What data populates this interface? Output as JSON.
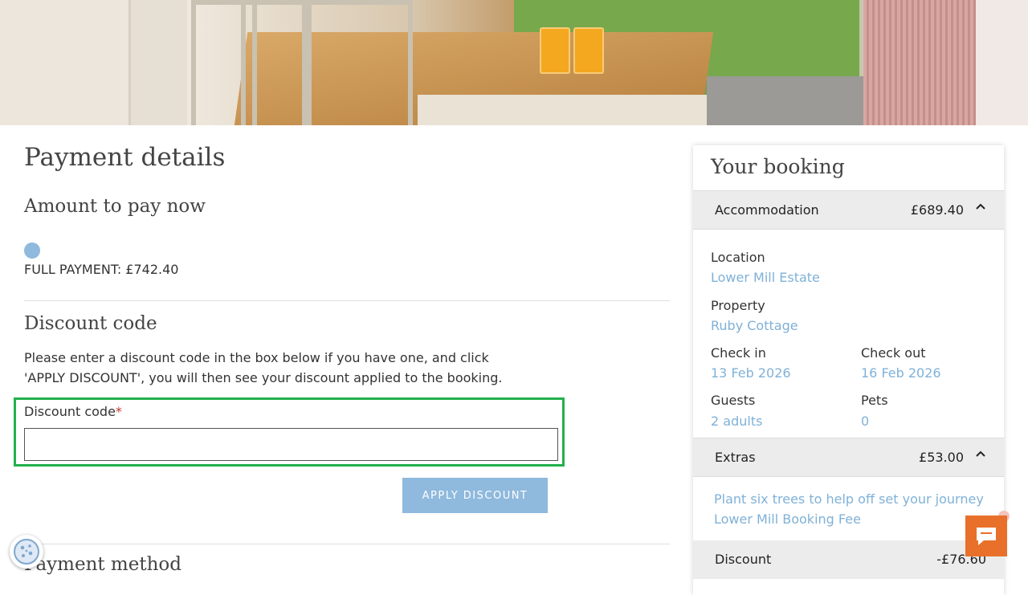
{
  "payment": {
    "title": "Payment details",
    "amount_heading": "Amount to pay now",
    "full_payment_label": "FULL PAYMENT: £742.40"
  },
  "discount": {
    "heading": "Discount code",
    "instructions": "Please enter a discount code in the box below if you have one, and click 'APPLY DISCOUNT', you will then see your discount applied to the booking.",
    "field_label": "Discount code",
    "required_marker": "*",
    "input_value": "",
    "apply_button": "APPLY DISCOUNT"
  },
  "payment_method": {
    "heading": "Payment method"
  },
  "booking": {
    "title": "Your booking",
    "accommodation": {
      "label": "Accommodation",
      "amount": "£689.40",
      "chevron": "^"
    },
    "location_label": "Location",
    "location_value": "Lower Mill Estate",
    "property_label": "Property",
    "property_value": "Ruby Cottage",
    "checkin_label": "Check in",
    "checkin_value": "13 Feb 2026",
    "checkout_label": "Check out",
    "checkout_value": "16 Feb 2026",
    "guests_label": "Guests",
    "guests_value": "2 adults",
    "pets_label": "Pets",
    "pets_value": "0",
    "extras": {
      "label": "Extras",
      "amount": "£53.00",
      "chevron": "^"
    },
    "extras_items": [
      "Plant six trees to help off set your journey",
      "Lower Mill Booking Fee"
    ],
    "discount": {
      "label": "Discount",
      "amount": "-£76.60"
    }
  },
  "icons": {
    "cookie": "cookie-icon",
    "chat": "chat-icon",
    "chevron": "chevron-up-icon"
  },
  "colors": {
    "accent_blue": "#8fb9dd",
    "link_blue": "#7fb1d8",
    "highlight_green": "#22b14c",
    "chat_orange": "#e8702a"
  }
}
